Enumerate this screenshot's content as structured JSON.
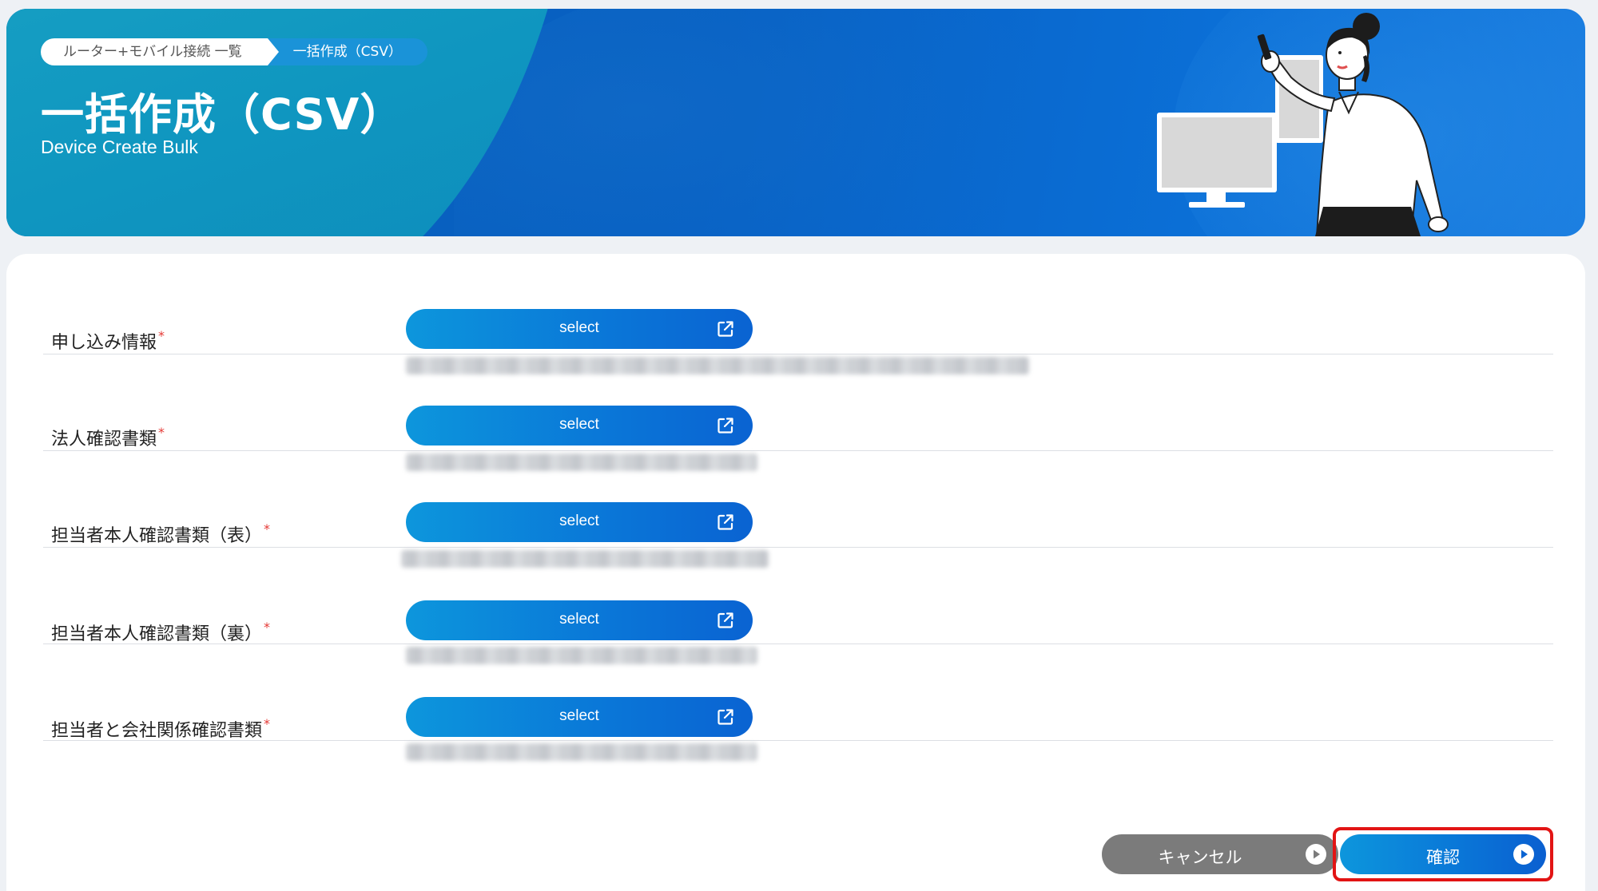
{
  "breadcrumb": {
    "parent": "ルーター+モバイル接続 一覧",
    "current": "一括作成（CSV）"
  },
  "hero": {
    "title": "一括作成（CSV）",
    "subtitle": "Device Create Bulk"
  },
  "form": {
    "rows": [
      {
        "label": "申し込み情報",
        "required_mark": "*",
        "button": "select"
      },
      {
        "label": "法人確認書類",
        "required_mark": "*",
        "button": "select"
      },
      {
        "label": "担当者本人確認書類（表）",
        "required_mark": "*",
        "button": "select"
      },
      {
        "label": "担当者本人確認書類（裏）",
        "required_mark": "*",
        "button": "select"
      },
      {
        "label": "担当者と会社関係確認書類",
        "required_mark": "*",
        "button": "select"
      }
    ]
  },
  "footer": {
    "cancel_label": "キャンセル",
    "confirm_label": "確認"
  },
  "colors": {
    "primary": "#0a78d8",
    "required": "#e53935",
    "cancel": "#7b7b7b",
    "highlight": "#e21414"
  },
  "icons": {
    "select_button": "external-link-icon",
    "footer_buttons": "play-circle-icon"
  }
}
